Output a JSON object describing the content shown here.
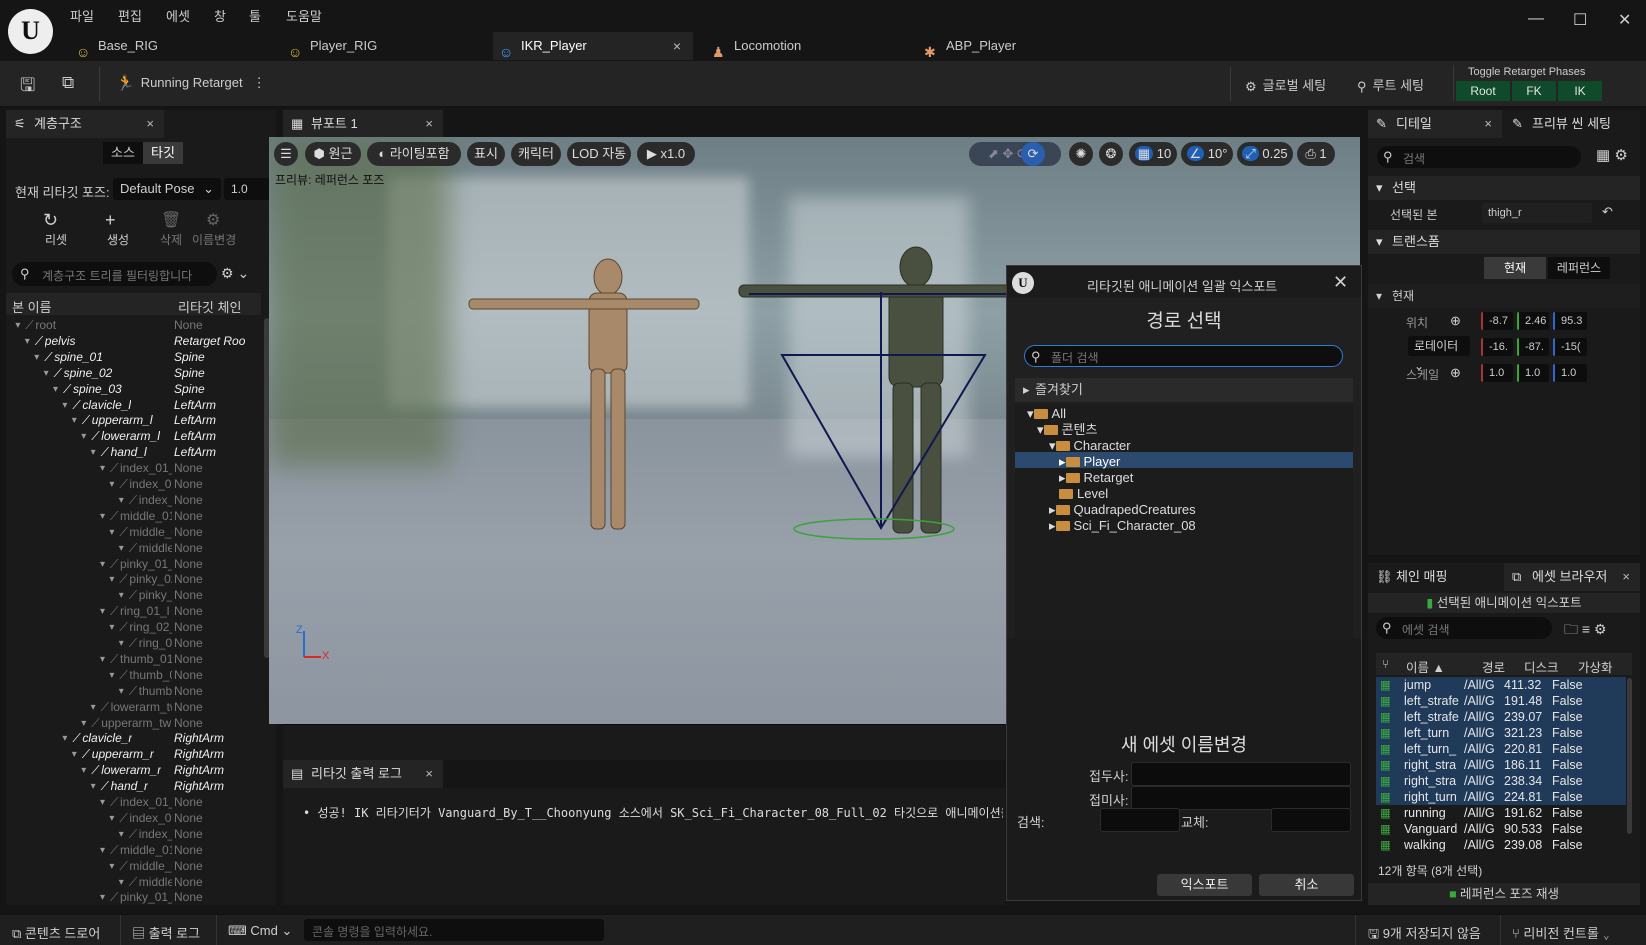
{
  "menu": [
    "파일",
    "편집",
    "에셋",
    "창",
    "툴",
    "도움말"
  ],
  "tabs": [
    {
      "label": "Base_RIG",
      "icon": "person-icon"
    },
    {
      "label": "Player_RIG",
      "icon": "person-icon"
    },
    {
      "label": "IKR_Player",
      "icon": "person-icon"
    },
    {
      "label": "Locomotion",
      "icon": "figures-icon"
    },
    {
      "label": "ABP_Player",
      "icon": "anim-icon"
    }
  ],
  "toolbar": {
    "running": "Running Retarget",
    "global": "글로벌 세팅",
    "root": "루트 세팅",
    "phases_title": "Toggle Retarget Phases",
    "phases": [
      "Root",
      "FK",
      "IK"
    ]
  },
  "hier": {
    "tab": "계층구조",
    "src": "소스",
    "tgt": "타깃",
    "pose_label": "현재 리타깃 포즈:",
    "pose_value": "Default Pose",
    "pose_num": "1.0",
    "reset": "리셋",
    "create": "생성",
    "del": "삭제",
    "rename": "이름변경",
    "filter_ph": "계층구조 트리를 필터링합니다",
    "col_bone": "본 이름",
    "col_chain": "리타깃 체인",
    "rows": [
      {
        "n": "root",
        "c": "None",
        "d": 1,
        "s": "dim"
      },
      {
        "n": "pelvis",
        "c": "Retarget Roo",
        "d": 2,
        "s": "hi"
      },
      {
        "n": "spine_01",
        "c": "Spine",
        "d": 3,
        "s": "hi"
      },
      {
        "n": "spine_02",
        "c": "Spine",
        "d": 4,
        "s": "hi"
      },
      {
        "n": "spine_03",
        "c": "Spine",
        "d": 5,
        "s": "hi"
      },
      {
        "n": "clavicle_l",
        "c": "LeftArm",
        "d": 6,
        "s": "hi"
      },
      {
        "n": "upperarm_l",
        "c": "LeftArm",
        "d": 7,
        "s": "hi"
      },
      {
        "n": "lowerarm_l",
        "c": "LeftArm",
        "d": 8,
        "s": "hi"
      },
      {
        "n": "hand_l",
        "c": "LeftArm",
        "d": 9,
        "s": "hi"
      },
      {
        "n": "index_01_l",
        "c": "None",
        "d": 10,
        "s": "dim"
      },
      {
        "n": "index_02_l",
        "c": "None",
        "d": 11,
        "s": "dim"
      },
      {
        "n": "index_0",
        "c": "None",
        "d": 12,
        "s": "dim"
      },
      {
        "n": "middle_01_l",
        "c": "None",
        "d": 10,
        "s": "dim"
      },
      {
        "n": "middle_02",
        "c": "None",
        "d": 11,
        "s": "dim"
      },
      {
        "n": "middle_l",
        "c": "None",
        "d": 12,
        "s": "dim"
      },
      {
        "n": "pinky_01_l",
        "c": "None",
        "d": 10,
        "s": "dim"
      },
      {
        "n": "pinky_02_l",
        "c": "None",
        "d": 11,
        "s": "dim"
      },
      {
        "n": "pinky_0",
        "c": "None",
        "d": 12,
        "s": "dim"
      },
      {
        "n": "ring_01_l",
        "c": "None",
        "d": 10,
        "s": "dim"
      },
      {
        "n": "ring_02_l",
        "c": "None",
        "d": 11,
        "s": "dim"
      },
      {
        "n": "ring_03_l",
        "c": "None",
        "d": 12,
        "s": "dim"
      },
      {
        "n": "thumb_01_l",
        "c": "None",
        "d": 10,
        "s": "dim"
      },
      {
        "n": "thumb_02",
        "c": "None",
        "d": 11,
        "s": "dim"
      },
      {
        "n": "thumb_l",
        "c": "None",
        "d": 12,
        "s": "dim"
      },
      {
        "n": "lowerarm_tw",
        "c": "None",
        "d": 9,
        "s": "dim"
      },
      {
        "n": "upperarm_twis",
        "c": "None",
        "d": 8,
        "s": "dim"
      },
      {
        "n": "clavicle_r",
        "c": "RightArm",
        "d": 6,
        "s": "hi"
      },
      {
        "n": "upperarm_r",
        "c": "RightArm",
        "d": 7,
        "s": "hi"
      },
      {
        "n": "lowerarm_r",
        "c": "RightArm",
        "d": 8,
        "s": "hi"
      },
      {
        "n": "hand_r",
        "c": "RightArm",
        "d": 9,
        "s": "hi"
      },
      {
        "n": "index_01_r",
        "c": "None",
        "d": 10,
        "s": "dim"
      },
      {
        "n": "index_02_r",
        "c": "None",
        "d": 11,
        "s": "dim"
      },
      {
        "n": "index_0",
        "c": "None",
        "d": 12,
        "s": "dim"
      },
      {
        "n": "middle_01_r",
        "c": "None",
        "d": 10,
        "s": "dim"
      },
      {
        "n": "middle_02",
        "c": "None",
        "d": 11,
        "s": "dim"
      },
      {
        "n": "middle_r",
        "c": "None",
        "d": 12,
        "s": "dim"
      },
      {
        "n": "pinky_01_r",
        "c": "None",
        "d": 10,
        "s": "dim"
      }
    ]
  },
  "viewport": {
    "tab": "뷰포트 1",
    "persp": "원근",
    "lit": "라이팅포함",
    "show": "표시",
    "char": "캐릭터",
    "lod": "LOD 자동",
    "play": "x1.0",
    "preview": "프리뷰: 레퍼런스 포즈",
    "grid": "10",
    "angle": "10°",
    "scale": "0.25",
    "cam": "1"
  },
  "log": {
    "tab": "리타깃 출력 로그",
    "line": "성공! IK 리타기터가 Vanguard_By_T__Choonyung 소스에서 SK_Sci_Fi_Character_08_Full_02 타깃으로 애니메이션을"
  },
  "dialog": {
    "title": "리타깃된 애니메이션 일괄 익스포트",
    "heading": "경로 선택",
    "search_ph": "폴더 검색",
    "favorites": "즐겨찾기",
    "tree": [
      {
        "n": "All",
        "x": 12
      },
      {
        "n": "콘텐츠",
        "x": 22
      },
      {
        "n": "Character",
        "x": 34
      },
      {
        "n": "Player",
        "x": 44
      },
      {
        "n": "Retarget",
        "x": 44
      },
      {
        "n": "Level",
        "x": 34
      },
      {
        "n": "QuadrapedCreatures",
        "x": 34
      },
      {
        "n": "Sci_Fi_Character_08",
        "x": 34
      }
    ],
    "rename_title": "새 에셋 이름변경",
    "prefix": "접두사:",
    "suffix": "접미사:",
    "search": "검색:",
    "replace": "교체:",
    "export": "익스포트",
    "cancel": "취소"
  },
  "details": {
    "tab": "디테일",
    "tab2": "프리뷰 씬 세팅",
    "search_ph": "검색",
    "sel_section": "선택",
    "sel_bone_label": "선택된 본",
    "sel_bone": "thigh_r",
    "transform": "트랜스폼",
    "cur": "현재",
    "ref": "레퍼런스",
    "cur_sec": "현재",
    "loc": "위치",
    "rot": "로테이터",
    "scale": "스케일",
    "loc_v": [
      "-8.7",
      "2.46",
      "95.3"
    ],
    "rot_v": [
      "-16.",
      "-87.",
      "-15("
    ],
    "scale_v": [
      "1.0",
      "1.0",
      "1.0"
    ]
  },
  "assets": {
    "tab": "체인 매핑",
    "tab2": "에셋 브라우저",
    "export_sel": "선택된 애니메이션 익스포트",
    "search_ph": "에셋 검색",
    "cols": [
      "이름 ▲",
      "경로",
      "디스크",
      "가상화"
    ],
    "rows": [
      {
        "n": "jump",
        "p": "/All/G",
        "s": "411.32",
        "v": "False",
        "sel": true
      },
      {
        "n": "left_strafe",
        "p": "/All/G",
        "s": "191.48",
        "v": "False",
        "sel": true
      },
      {
        "n": "left_strafe",
        "p": "/All/G",
        "s": "239.07",
        "v": "False",
        "sel": true
      },
      {
        "n": "left_turn",
        "p": "/All/G",
        "s": "321.23",
        "v": "False",
        "sel": true
      },
      {
        "n": "left_turn_",
        "p": "/All/G",
        "s": "220.81",
        "v": "False",
        "sel": true
      },
      {
        "n": "right_stra",
        "p": "/All/G",
        "s": "186.11",
        "v": "False",
        "sel": true
      },
      {
        "n": "right_stra",
        "p": "/All/G",
        "s": "238.34",
        "v": "False",
        "sel": true
      },
      {
        "n": "right_turn",
        "p": "/All/G",
        "s": "224.81",
        "v": "False",
        "sel": true
      },
      {
        "n": "running",
        "p": "/All/G",
        "s": "191.62",
        "v": "False",
        "sel": false
      },
      {
        "n": "Vanguard",
        "p": "/All/G",
        "s": "90.533",
        "v": "False",
        "sel": false
      },
      {
        "n": "walking",
        "p": "/All/G",
        "s": "239.08",
        "v": "False",
        "sel": false
      }
    ],
    "count": "12개 항목 (8개 선택)",
    "play": "레퍼런스 포즈 재생"
  },
  "status": {
    "drawer": "콘텐츠 드로어",
    "outlog": "출력 로그",
    "cmd": "Cmd",
    "cmd_ph": "콘솔 명령을 입력하세요.",
    "unsaved": "9개 저장되지 않음",
    "revision": "리비전 컨트롤"
  }
}
